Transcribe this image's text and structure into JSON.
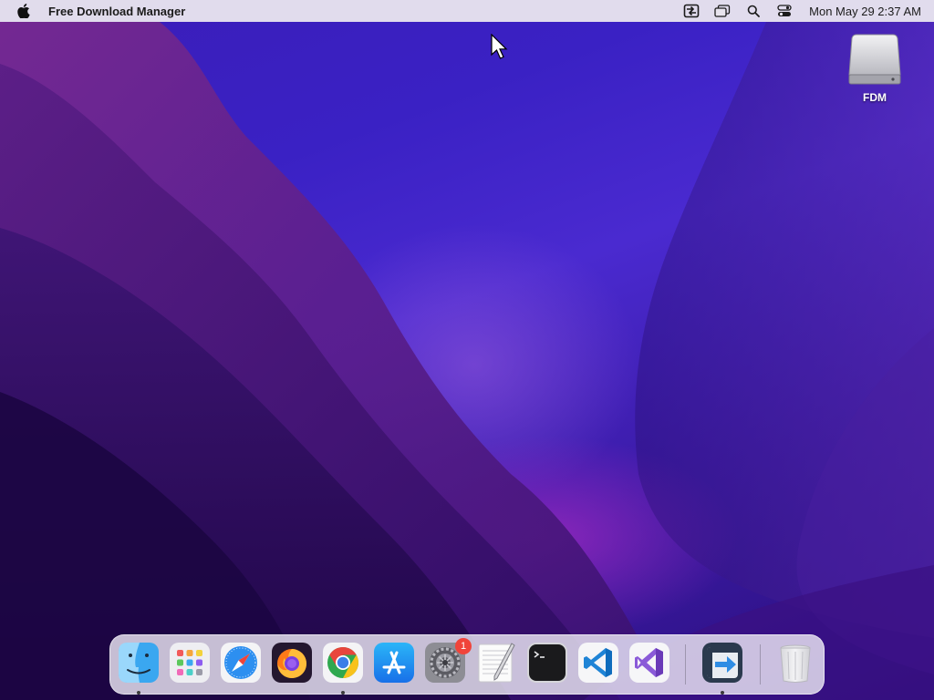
{
  "menubar": {
    "app_name": "Free Download Manager",
    "clock": "Mon May 29  2:37 AM",
    "icons": [
      "fdm-menubar-icon",
      "window-switcher-icon",
      "search-icon",
      "control-center-icon"
    ]
  },
  "desktop": {
    "drive_label": "FDM"
  },
  "dock": {
    "apps": [
      {
        "name": "Finder",
        "icon": "finder-icon",
        "running": true
      },
      {
        "name": "Launchpad",
        "icon": "launchpad-icon",
        "running": false
      },
      {
        "name": "Safari",
        "icon": "safari-icon",
        "running": false
      },
      {
        "name": "Firefox",
        "icon": "firefox-icon",
        "running": false
      },
      {
        "name": "Google Chrome",
        "icon": "chrome-icon",
        "running": true
      },
      {
        "name": "App Store",
        "icon": "app-store-icon",
        "running": false
      },
      {
        "name": "System Preferences",
        "icon": "system-preferences-icon",
        "running": false,
        "badge": "1"
      },
      {
        "name": "TextEdit",
        "icon": "textedit-icon",
        "running": false
      },
      {
        "name": "Terminal",
        "icon": "terminal-icon",
        "running": false
      },
      {
        "name": "Visual Studio Code",
        "icon": "vscode-icon",
        "running": false
      },
      {
        "name": "Visual Studio",
        "icon": "visual-studio-icon",
        "running": false
      },
      {
        "name": "Free Download Manager",
        "icon": "fdm-icon",
        "running": true
      },
      {
        "name": "Trash",
        "icon": "trash-icon",
        "running": false
      }
    ],
    "system_prefs_badge": "1"
  },
  "colors": {
    "wallpaper_primary": "#3a21c4",
    "wallpaper_accent": "#9a2fc0",
    "menubar": "#e8e4ee",
    "badge": "#f0443a"
  }
}
